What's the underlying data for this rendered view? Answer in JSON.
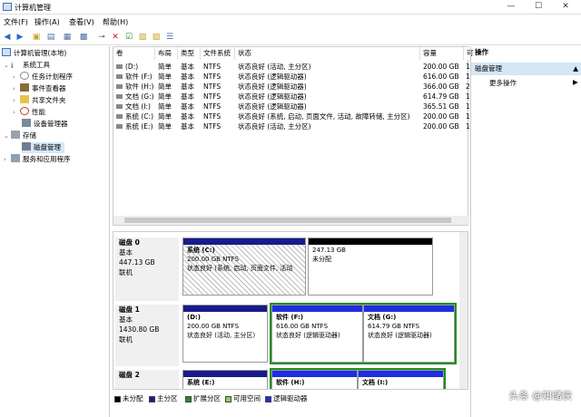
{
  "window": {
    "title": "计算机管理"
  },
  "menu": [
    "文件(F)",
    "操作(A)",
    "查看(V)",
    "帮助(H)"
  ],
  "tree": {
    "root": "计算机管理(本地)",
    "system_tools": "系统工具",
    "task_scheduler": "任务计划程序",
    "event_viewer": "事件查看器",
    "shared_folders": "共享文件夹",
    "performance": "性能",
    "device_manager": "设备管理器",
    "storage": "存储",
    "disk_management": "磁盘管理",
    "services": "服务和应用程序"
  },
  "columns": [
    "卷",
    "布局",
    "类型",
    "文件系统",
    "状态",
    "容量",
    "可"
  ],
  "volumes": [
    {
      "name": "(D:)",
      "layout": "简单",
      "type": "基本",
      "fs": "NTFS",
      "status": "状态良好 (活动, 主分区)",
      "capacity": "200.00 GB",
      "free": "1"
    },
    {
      "name": "软件 (F:)",
      "layout": "简单",
      "type": "基本",
      "fs": "NTFS",
      "status": "状态良好 (逻辑驱动器)",
      "capacity": "616.00 GB",
      "free": "1"
    },
    {
      "name": "软件 (H:)",
      "layout": "简单",
      "type": "基本",
      "fs": "NTFS",
      "status": "状态良好 (逻辑驱动器)",
      "capacity": "366.00 GB",
      "free": "2"
    },
    {
      "name": "文档 (G:)",
      "layout": "简单",
      "type": "基本",
      "fs": "NTFS",
      "status": "状态良好 (逻辑驱动器)",
      "capacity": "614.79 GB",
      "free": "1"
    },
    {
      "name": "文档 (I:)",
      "layout": "简单",
      "type": "基本",
      "fs": "NTFS",
      "status": "状态良好 (逻辑驱动器)",
      "capacity": "365.51 GB",
      "free": "1"
    },
    {
      "name": "系统 (C:)",
      "layout": "简单",
      "type": "基本",
      "fs": "NTFS",
      "status": "状态良好 (系统, 启动, 页面文件, 活动, 故障转储, 主分区)",
      "capacity": "200.00 GB",
      "free": "1"
    },
    {
      "name": "系统 (E:)",
      "layout": "简单",
      "type": "基本",
      "fs": "NTFS",
      "status": "状态良好 (活动, 主分区)",
      "capacity": "200.00 GB",
      "free": "1"
    }
  ],
  "disks": [
    {
      "name": "磁盘 0",
      "kind": "基本",
      "size": "447.13 GB",
      "state": "联机",
      "parts": [
        {
          "title": "系统 (C:)",
          "size": "200.00 GB NTFS",
          "status": "状态良好 (系统, 启动, 页面文件, 活动"
        },
        {
          "title": "",
          "size": "247.13 GB",
          "status": "未分配"
        }
      ]
    },
    {
      "name": "磁盘 1",
      "kind": "基本",
      "size": "1430.80 GB",
      "state": "联机",
      "parts": [
        {
          "title": "(D:)",
          "size": "200.00 GB NTFS",
          "status": "状态良好 (活动, 主分区)"
        },
        {
          "title": "软件 (F:)",
          "size": "616.00 GB NTFS",
          "status": "状态良好 (逻辑驱动器)"
        },
        {
          "title": "文档 (G:)",
          "size": "614.79 GB NTFS",
          "status": "状态良好 (逻辑驱动器)"
        }
      ]
    },
    {
      "name": "磁盘 2",
      "parts": [
        {
          "title": "系统 (E:)"
        },
        {
          "title": "软件 (H:)"
        },
        {
          "title": "文档 (I:)"
        }
      ]
    }
  ],
  "legend": [
    "未分配",
    "主分区",
    "扩展分区",
    "可用空间",
    "逻辑驱动器"
  ],
  "legend_colors": [
    "#000000",
    "#1a1a8c",
    "#2e8b2e",
    "#8ccf4d",
    "#1e2ee0"
  ],
  "actions": {
    "header": "操作",
    "selected": "磁盘管理",
    "more": "更多操作"
  },
  "watermark": "头条 @知储侠"
}
